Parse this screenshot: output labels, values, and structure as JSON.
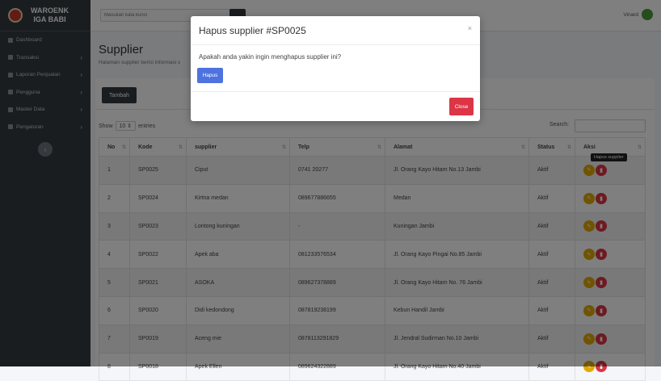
{
  "brand": {
    "line1": "WAROENK",
    "line2": "IGA BABI"
  },
  "sidebar": {
    "items": [
      {
        "label": "Dashboard",
        "has_children": false
      },
      {
        "label": "Transaksi",
        "has_children": true
      },
      {
        "label": "Laporan Penjualan",
        "has_children": true
      },
      {
        "label": "Pengguna",
        "has_children": true
      },
      {
        "label": "Master Data",
        "has_children": true
      },
      {
        "label": "Pengaturan",
        "has_children": true
      }
    ]
  },
  "topbar": {
    "search_placeholder": "Masukan kata kunci",
    "user_name": "Vinard"
  },
  "page": {
    "title": "Supplier",
    "subtitle": "Halaman supplier berisi informasi s"
  },
  "toolbar": {
    "add_label": "Tambah",
    "show_label": "Show",
    "entries_value": "10",
    "entries_label": "entries",
    "search_label": "Search:"
  },
  "table": {
    "columns": [
      "No",
      "Kode",
      "supplier",
      "Telp",
      "Alamat",
      "Status",
      "Aksi"
    ],
    "rows": [
      {
        "no": "1",
        "kode": "SP0025",
        "supplier": "Ciput",
        "telp": "0741 20277",
        "alamat": "Jl. Orang Kayo Hitam No.13 Jambi",
        "status": "Aktif"
      },
      {
        "no": "2",
        "kode": "SP0024",
        "supplier": "Kirtna medan",
        "telp": "089677886655",
        "alamat": "Medan",
        "status": "Aktif"
      },
      {
        "no": "3",
        "kode": "SP0023",
        "supplier": "Lontong kuningan",
        "telp": "-",
        "alamat": "Kuningan Jambi",
        "status": "Aktif"
      },
      {
        "no": "4",
        "kode": "SP0022",
        "supplier": "Apek aba",
        "telp": "081233576534",
        "alamat": "Jl. Orang Kayo Pingai No.85 Jambi",
        "status": "Aktif"
      },
      {
        "no": "5",
        "kode": "SP0021",
        "supplier": "ASOKA",
        "telp": "089627378889",
        "alamat": "Jl. Orang Kayo Hitam No. 76 Jambi",
        "status": "Aktif"
      },
      {
        "no": "6",
        "kode": "SP0020",
        "supplier": "Didi kedondong",
        "telp": "087819238199",
        "alamat": "Kebun Handil Jambi",
        "status": "Aktif"
      },
      {
        "no": "7",
        "kode": "SP0019",
        "supplier": "Aceng mie",
        "telp": "0878113291829",
        "alamat": "Jl. Jendral Sudirman No.10 Jambi",
        "status": "Aktif"
      },
      {
        "no": "8",
        "kode": "SP0018",
        "supplier": "Apek Ellen",
        "telp": "089624322889",
        "alamat": "Jl. Orang Kayo Hitam No.40 Jambi",
        "status": "Aktif"
      }
    ]
  },
  "tooltip": "Hapus supplier",
  "modal": {
    "title": "Hapus supplier #SP0025",
    "close_icon": "×",
    "message": "Apakah anda yakin ingin menghapus supplier ini?",
    "confirm_label": "Hapus",
    "close_label": "Close"
  },
  "colors": {
    "sidebar": "#343a40",
    "primary": "#4e73df",
    "danger": "#dc3545",
    "warning": "#e0a800"
  }
}
